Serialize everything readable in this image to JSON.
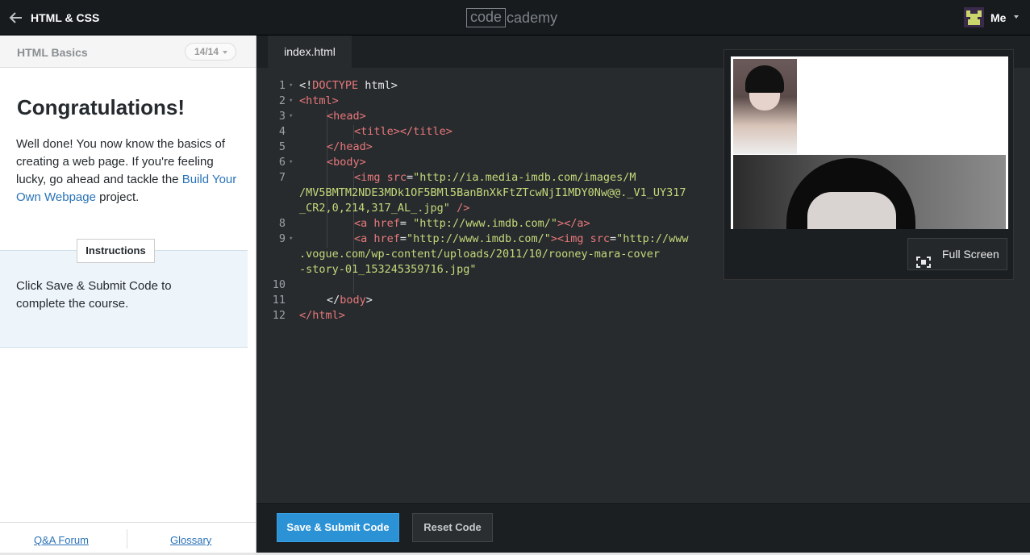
{
  "topbar": {
    "back_icon": "arrow-left-icon",
    "course_title": "HTML & CSS",
    "logo_boxed": "code",
    "logo_rest": "cademy",
    "user_name": "Me"
  },
  "lesson": {
    "section_name": "HTML Basics",
    "progress": "14/14",
    "heading": "Congratulations!",
    "desc_part1": "Well done! You now know the basics of creating a web page. If you're feeling lucky, go ahead and tackle the ",
    "desc_link": "Build Your Own Webpage",
    "desc_part2": " project.",
    "instructions_tab": "Instructions",
    "instructions_text": "Click Save & Submit Code to complete the course."
  },
  "footer": {
    "qa_link": "Q&A Forum",
    "glossary_link": "Glossary"
  },
  "editor": {
    "file_tab": "index.html",
    "line_numbers": [
      "1",
      "2",
      "3",
      "4",
      "5",
      "6",
      "7",
      "8",
      "9",
      "10",
      "11",
      "12"
    ],
    "code": {
      "l1_a": "<!",
      "l1_b": "DOCTYPE",
      "l1_c": " html>",
      "l2": "<html>",
      "l3": "<head>",
      "l4": "<title></title>",
      "l5": "</head>",
      "l6": "<body>",
      "l7_tag": "<img src",
      "l7_eq": "=",
      "l7_url1": "\"http://ia.media-imdb.com/images/M",
      "l7_url2": "/MV5BMTM2NDE3MDk1OF5BMl5BanBnXkFtZTcwNjI1MDY0Nw@@._V1_UY317",
      "l7_url3": "_CR2,0,214,317_AL_.jpg\"",
      "l7_close": " />",
      "l8_tag": "<a href",
      "l8_eq": "= ",
      "l8_url": "\"http://www.imdb.com/\"",
      "l8_close": "></a>",
      "l9_tag": "<a href",
      "l9_eq": "=",
      "l9_url": "\"http://www.imdb.com/\"",
      "l9_img": "><img src",
      "l9_eq2": "=",
      "l9_url2a": "\"http://www",
      "l9_url2b": ".vogue.com/wp-content/uploads/2011/10/rooney-mara-cover",
      "l9_url2c": "-story-01_153245359716.jpg\"",
      "l11_a": "</",
      "l11_b": "body",
      "l11_c": ">",
      "l12": "</html>"
    }
  },
  "preview": {
    "fullscreen_label": "Full Screen"
  },
  "actions": {
    "submit_label": "Save & Submit Code",
    "reset_label": "Reset Code"
  }
}
